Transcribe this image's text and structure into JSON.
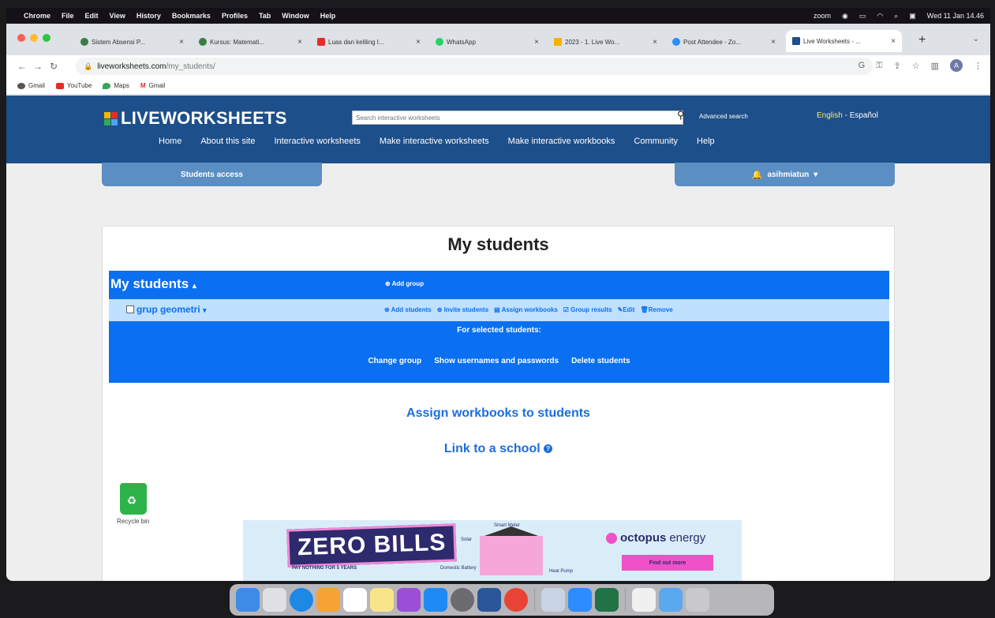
{
  "menubar": {
    "app": "Chrome",
    "items": [
      "File",
      "Edit",
      "View",
      "History",
      "Bookmarks",
      "Profiles",
      "Tab",
      "Window",
      "Help"
    ],
    "zoom": "zoom",
    "clock": "Wed 11 Jan 14.46"
  },
  "tabs": [
    {
      "title": "Sistem Absensi P...",
      "color": "#3a7d44"
    },
    {
      "title": "Kursus: Matemati...",
      "color": "#3a7d44"
    },
    {
      "title": "Luas dan keliling l...",
      "color": "#e52d27"
    },
    {
      "title": "WhatsApp",
      "color": "#25d366"
    },
    {
      "title": "2023 - 1. Live Wo...",
      "color": "#f4b400"
    },
    {
      "title": "Post Attendee - Zo...",
      "color": "#2d8cff"
    },
    {
      "title": "Live Worksheets - ...",
      "color": "#1d4f8a"
    }
  ],
  "address": {
    "domain": "liveworksheets.com",
    "path": "/my_students/"
  },
  "bookmarks": [
    {
      "label": "Gmail",
      "color": "#555"
    },
    {
      "label": "YouTube",
      "color": "#e52d27"
    },
    {
      "label": "Maps",
      "color": "#34a853"
    },
    {
      "label": "Gmail",
      "color": "#d93025"
    }
  ],
  "site": {
    "logo": "LIVEWORKSHEETS",
    "search_placeholder": "Search interactive worksheets",
    "advanced_search": "Advanced search",
    "lang_en": "English",
    "lang_sep": " - ",
    "lang_es": "Español",
    "nav": [
      "Home",
      "About this site",
      "Interactive worksheets",
      "Make interactive worksheets",
      "Make interactive workbooks",
      "Community",
      "Help"
    ],
    "students_access": "Students access",
    "username": "asihmiatun"
  },
  "page": {
    "title": "My students",
    "panel_title": "My students",
    "add_group": "Add group",
    "group": {
      "name": "grup geometri",
      "actions": [
        "Add students",
        "Invite students",
        "Assign workbooks",
        "Group results",
        "Edit",
        "Remove"
      ]
    },
    "for_selected": "For selected students:",
    "bulk_actions": [
      "Change group",
      "Show usernames and passwords",
      "Delete students"
    ],
    "assign_workbooks": "Assign workbooks to students",
    "link_school": "Link to a school"
  },
  "desktop": {
    "trash_label": "Recycle bin"
  },
  "ad": {
    "headline": "ZERO BILLS",
    "sub": "PAY NOTHING FOR 5 YEARS",
    "brand": "octopus",
    "brand2": "energy",
    "cta": "Find out more",
    "labels": [
      "Smart Meter",
      "Solar",
      "Domestic Battery",
      "Heat Pump"
    ]
  },
  "colors": {
    "header": "#1d4f8a",
    "panel": "#0a6ff0",
    "group_row": "#bfe0ff",
    "link": "#1b6ee0"
  },
  "dock_icons": [
    "finder-icon",
    "launchpad-icon",
    "safari-icon",
    "photos-icon",
    "calendar-icon",
    "notes-icon",
    "podcasts-icon",
    "appstore-icon",
    "settings-icon",
    "word-icon",
    "chrome-icon",
    "preview-icon",
    "zoom-icon",
    "excel-icon",
    "notes2-icon",
    "folder-icon",
    "trash-icon"
  ]
}
